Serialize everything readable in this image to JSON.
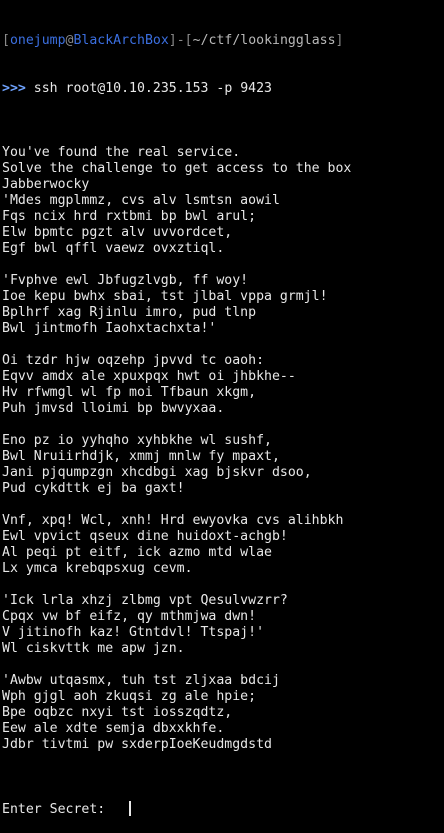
{
  "prompt": {
    "open_bracket": "[",
    "user": "onejump",
    "at": "@",
    "host": "BlackArchBox",
    "close_bracket": "]",
    "dash": "-",
    "path_open": "[",
    "path": "~/ctf/lookingglass",
    "path_close": "]",
    "arrows": ">>>",
    "command": "ssh root@10.10.235.153 -p 9423"
  },
  "output": [
    "You've found the real service.",
    "Solve the challenge to get access to the box",
    "Jabberwocky",
    "'Mdes mgplmmz, cvs alv lsmtsn aowil",
    "Fqs ncix hrd rxtbmi bp bwl arul;",
    "Elw bpmtc pgzt alv uvvordcet,",
    "Egf bwl qffl vaewz ovxztiql.",
    "",
    "'Fvphve ewl Jbfugzlvgb, ff woy!",
    "Ioe kepu bwhx sbai, tst jlbal vppa grmjl!",
    "Bplhrf xag Rjinlu imro, pud tlnp",
    "Bwl jintmofh Iaohxtachxta!'",
    "",
    "Oi tzdr hjw oqzehp jpvvd tc oaoh:",
    "Eqvv amdx ale xpuxpqx hwt oi jhbkhe--",
    "Hv rfwmgl wl fp moi Tfbaun xkgm,",
    "Puh jmvsd lloimi bp bwvyxaa.",
    "",
    "Eno pz io yyhqho xyhbkhe wl sushf,",
    "Bwl Nruiirhdjk, xmmj mnlw fy mpaxt,",
    "Jani pjqumpzgn xhcdbgi xag bjskvr dsoo,",
    "Pud cykdttk ej ba gaxt!",
    "",
    "Vnf, xpq! Wcl, xnh! Hrd ewyovka cvs alihbkh",
    "Ewl vpvict qseux dine huidoxt-achgb!",
    "Al peqi pt eitf, ick azmo mtd wlae",
    "Lx ymca krebqpsxug cevm.",
    "",
    "'Ick lrla xhzj zlbmg vpt Qesulvwzrr?",
    "Cpqx vw bf eifz, qy mthmjwa dwn!",
    "V jitinofh kaz! Gtntdvl! Ttspaj!'",
    "Wl ciskvttk me apw jzn.",
    "",
    "'Awbw utqasmx, tuh tst zljxaa bdcij",
    "Wph gjgl aoh zkuqsi zg ale hpie;",
    "Bpe oqbzc nxyi tst iosszqdtz,",
    "Eew ale xdte semja dbxxkhfe.",
    "Jdbr tivtmi pw sxderpIoeKeudmgdstd"
  ],
  "secret_prompt": {
    "label": "Enter Secret:"
  },
  "colors": {
    "background": "#000000",
    "text": "#e8e8e8",
    "user": "#3b6fe0",
    "bracket": "#8a8a8a",
    "arrows": "#6fa3ff"
  }
}
